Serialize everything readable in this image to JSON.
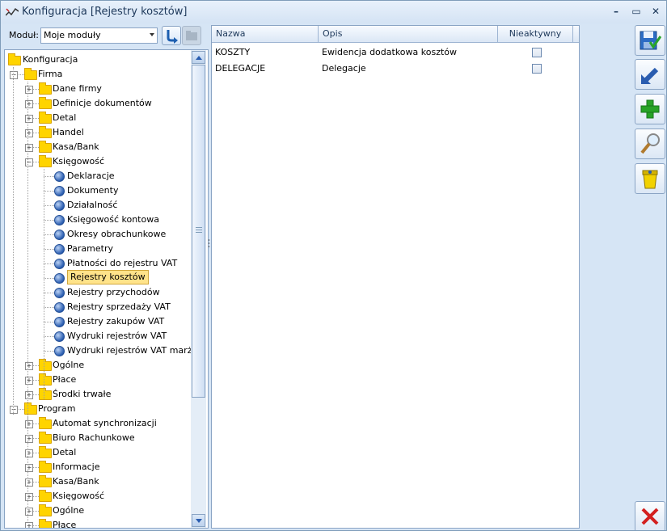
{
  "window": {
    "title": "Konfiguracja [Rejestry kosztów]"
  },
  "module": {
    "label": "Moduł:",
    "value": "Moje moduły"
  },
  "tree": [
    {
      "label": "Konfiguracja",
      "level": 0,
      "type": "folder",
      "selected": false
    },
    {
      "label": "Firma",
      "level": 1,
      "type": "folder",
      "selected": false
    },
    {
      "label": "Dane firmy",
      "level": 2,
      "type": "folder",
      "selected": false
    },
    {
      "label": "Definicje dokumentów",
      "level": 2,
      "type": "folder",
      "selected": false
    },
    {
      "label": "Detal",
      "level": 2,
      "type": "folder",
      "selected": false
    },
    {
      "label": "Handel",
      "level": 2,
      "type": "folder",
      "selected": false
    },
    {
      "label": "Kasa/Bank",
      "level": 2,
      "type": "folder",
      "selected": false
    },
    {
      "label": "Księgowość",
      "level": 2,
      "type": "folder",
      "selected": false
    },
    {
      "label": "Deklaracje",
      "level": 3,
      "type": "leaf",
      "selected": false
    },
    {
      "label": "Dokumenty",
      "level": 3,
      "type": "leaf",
      "selected": false
    },
    {
      "label": "Działalność",
      "level": 3,
      "type": "leaf",
      "selected": false
    },
    {
      "label": "Księgowość kontowa",
      "level": 3,
      "type": "leaf",
      "selected": false
    },
    {
      "label": "Okresy obrachunkowe",
      "level": 3,
      "type": "leaf",
      "selected": false
    },
    {
      "label": "Parametry",
      "level": 3,
      "type": "leaf",
      "selected": false
    },
    {
      "label": "Płatności do rejestru VAT",
      "level": 3,
      "type": "leaf",
      "selected": false
    },
    {
      "label": "Rejestry kosztów",
      "level": 3,
      "type": "leaf",
      "selected": true
    },
    {
      "label": "Rejestry przychodów",
      "level": 3,
      "type": "leaf",
      "selected": false
    },
    {
      "label": "Rejestry sprzedaży VAT",
      "level": 3,
      "type": "leaf",
      "selected": false
    },
    {
      "label": "Rejestry zakupów VAT",
      "level": 3,
      "type": "leaf",
      "selected": false
    },
    {
      "label": "Wydruki rejestrów VAT",
      "level": 3,
      "type": "leaf",
      "selected": false
    },
    {
      "label": "Wydruki rejestrów VAT marża",
      "level": 3,
      "type": "leaf",
      "selected": false
    },
    {
      "label": "Ogólne",
      "level": 2,
      "type": "folder",
      "selected": false
    },
    {
      "label": "Płace",
      "level": 2,
      "type": "folder",
      "selected": false
    },
    {
      "label": "Środki trwałe",
      "level": 2,
      "type": "folder",
      "selected": false
    },
    {
      "label": "Program",
      "level": 1,
      "type": "folder",
      "selected": false
    },
    {
      "label": "Automat synchronizacji",
      "level": 2,
      "type": "folder",
      "selected": false
    },
    {
      "label": "Biuro Rachunkowe",
      "level": 2,
      "type": "folder",
      "selected": false
    },
    {
      "label": "Detal",
      "level": 2,
      "type": "folder",
      "selected": false
    },
    {
      "label": "Informacje",
      "level": 2,
      "type": "folder",
      "selected": false
    },
    {
      "label": "Kasa/Bank",
      "level": 2,
      "type": "folder",
      "selected": false
    },
    {
      "label": "Księgowość",
      "level": 2,
      "type": "folder",
      "selected": false
    },
    {
      "label": "Ogólne",
      "level": 2,
      "type": "folder",
      "selected": false
    },
    {
      "label": "Płace",
      "level": 2,
      "type": "folder",
      "selected": false
    }
  ],
  "grid": {
    "headers": [
      "Nazwa",
      "Opis",
      "Nieaktywny"
    ],
    "rows": [
      {
        "nazwa": "KOSZTY",
        "opis": "Ewidencja dodatkowa kosztów",
        "nieaktywny": false
      },
      {
        "nazwa": "DELEGACJE",
        "opis": "Delegacje",
        "nieaktywny": false
      }
    ]
  },
  "actions": [
    {
      "name": "save-icon"
    },
    {
      "name": "undo-icon"
    },
    {
      "name": "add-icon"
    },
    {
      "name": "preview-icon"
    },
    {
      "name": "delete-icon"
    },
    {
      "name": "close-icon"
    }
  ]
}
